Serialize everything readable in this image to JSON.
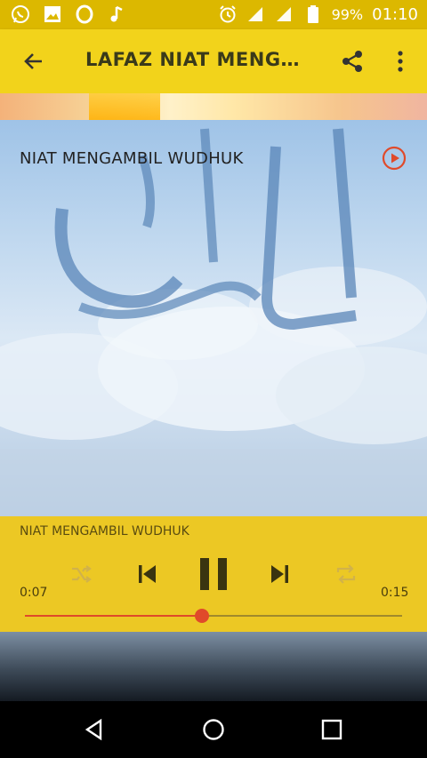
{
  "status_bar": {
    "battery": "99%",
    "time": "01:10",
    "left_icons": [
      "whatsapp-icon",
      "image-icon",
      "circle-app-icon",
      "music-note-icon"
    ],
    "right_icons": [
      "alarm-icon",
      "signal-icon",
      "signal-icon",
      "battery-icon"
    ]
  },
  "app_bar": {
    "title": "LAFAZ NIAT MENG…",
    "icons": [
      "back-arrow-icon",
      "share-icon",
      "more-vert-icon"
    ]
  },
  "list": {
    "items": [
      {
        "title": "NIAT MENGAMBIL WUDHUK",
        "icon": "play-circle-icon"
      }
    ]
  },
  "player": {
    "now_playing": "NIAT MENGAMBIL WUDHUK",
    "elapsed": "0:07",
    "duration": "0:15",
    "progress_fraction": 0.47,
    "state": "playing",
    "colors": {
      "accent": "#e04a2a",
      "bar": "#ecc824"
    }
  },
  "nav_bar": {
    "icons": [
      "back-triangle-icon",
      "home-circle-icon",
      "recents-square-icon"
    ]
  }
}
